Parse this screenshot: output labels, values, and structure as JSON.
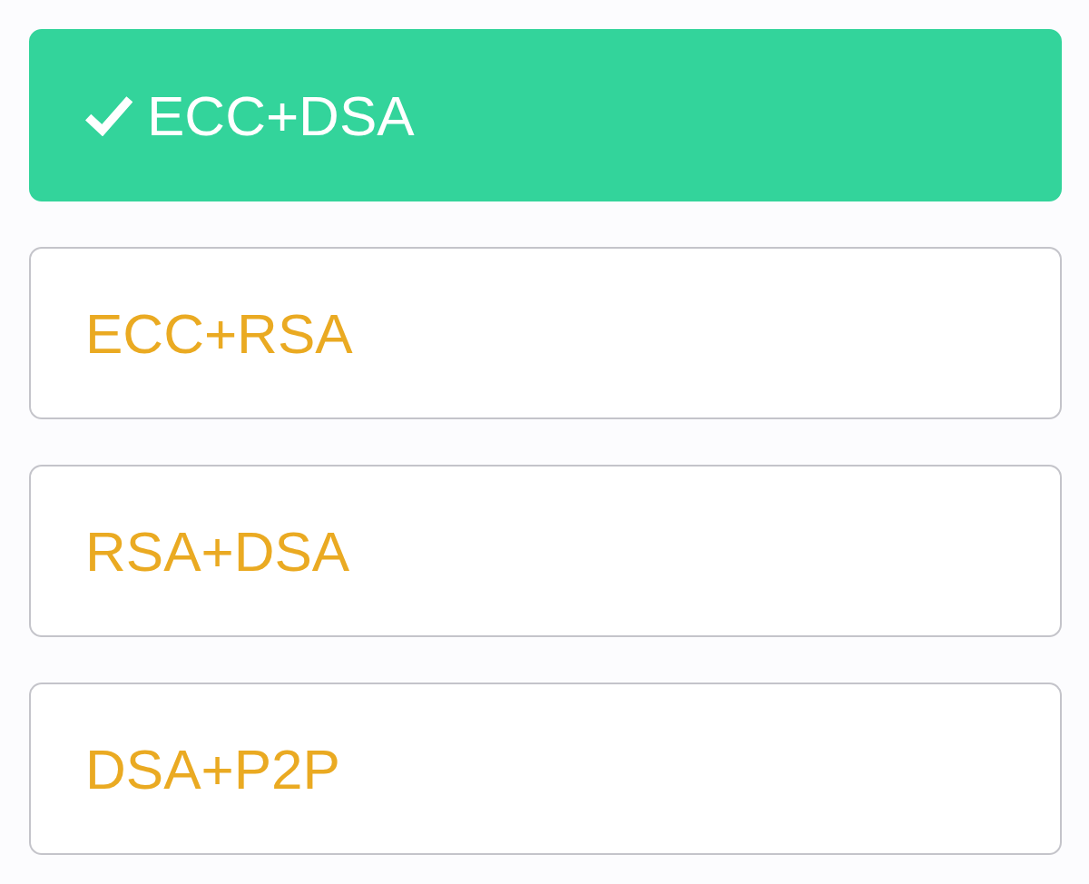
{
  "options": [
    {
      "label": "ECC+DSA",
      "selected": true
    },
    {
      "label": "ECC+RSA",
      "selected": false
    },
    {
      "label": "RSA+DSA",
      "selected": false
    },
    {
      "label": "DSA+P2P",
      "selected": false
    }
  ]
}
